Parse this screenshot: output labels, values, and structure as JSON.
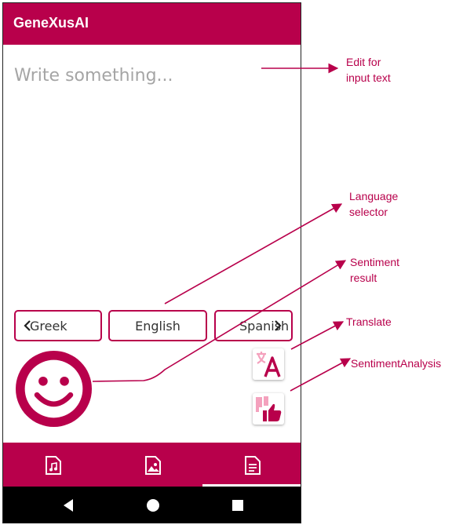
{
  "app": {
    "title": "GeneXusAI"
  },
  "input": {
    "placeholder": "Write something..."
  },
  "languages": {
    "left": "Greek",
    "center": "English",
    "right": "Spanish"
  },
  "icons": {
    "smiley": "smiley-face-icon",
    "translate": "translate-icon",
    "sentiment": "thumbs-icon",
    "nav": [
      "music-file-icon",
      "image-file-icon",
      "document-file-icon"
    ],
    "system": [
      "back-icon",
      "home-icon",
      "recents-icon"
    ]
  },
  "bottom_nav": {
    "selected_tab": "document"
  },
  "annotations": {
    "edit_line1": "Edit for",
    "edit_line2": "input text",
    "language_line1": "Language",
    "language_line2": "selector",
    "sentiment_line1": "Sentiment",
    "sentiment_line2": "result",
    "translate": "Translate",
    "sentiment_analysis": "SentimentAnalysis"
  },
  "colors": {
    "accent": "#b8004b",
    "system_bar": "#000000",
    "annotation": "#b8004b"
  }
}
